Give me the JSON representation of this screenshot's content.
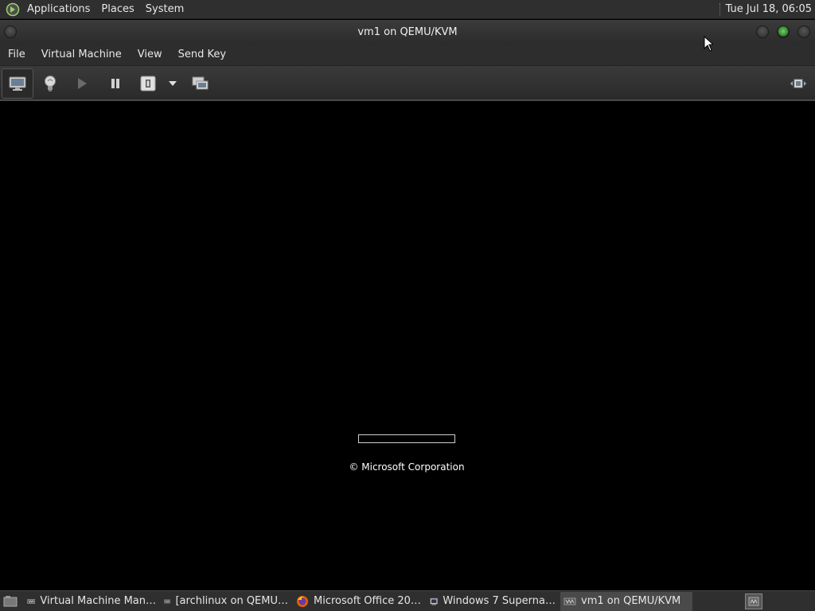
{
  "top_panel": {
    "menus": [
      "Applications",
      "Places",
      "System"
    ],
    "clock": "Tue Jul 18, 06:05"
  },
  "window": {
    "title": "vm1 on QEMU/KVM"
  },
  "menubar": {
    "items": [
      "File",
      "Virtual Machine",
      "View",
      "Send Key"
    ]
  },
  "toolbar": {
    "icons": [
      "monitor-icon",
      "lightbulb-icon",
      "play-icon",
      "pause-icon",
      "power-icon",
      "dropdown-arrow-icon",
      "snapshots-icon",
      "fullscreen-icon"
    ]
  },
  "vm_screen": {
    "boot_progress_fraction": 0.0,
    "copyright": "© Microsoft Corporation"
  },
  "taskbar": {
    "tasks": [
      {
        "label": "Virtual Machine Man…",
        "icon": "virt-manager-icon",
        "active": false
      },
      {
        "label": "[archlinux on QEMU…",
        "icon": "virt-manager-icon",
        "active": false
      },
      {
        "label": "Microsoft Office 20…",
        "icon": "firefox-icon",
        "active": false
      },
      {
        "label": "Windows 7 Superna…",
        "icon": "terminal-icon",
        "active": false
      },
      {
        "label": "vm1 on QEMU/KVM",
        "icon": "virt-manager-icon",
        "active": true
      }
    ]
  },
  "colors": {
    "panel_bg": "#2f2f2f",
    "vm_bg": "#000000",
    "maximize_green": "#4fbf4a"
  }
}
